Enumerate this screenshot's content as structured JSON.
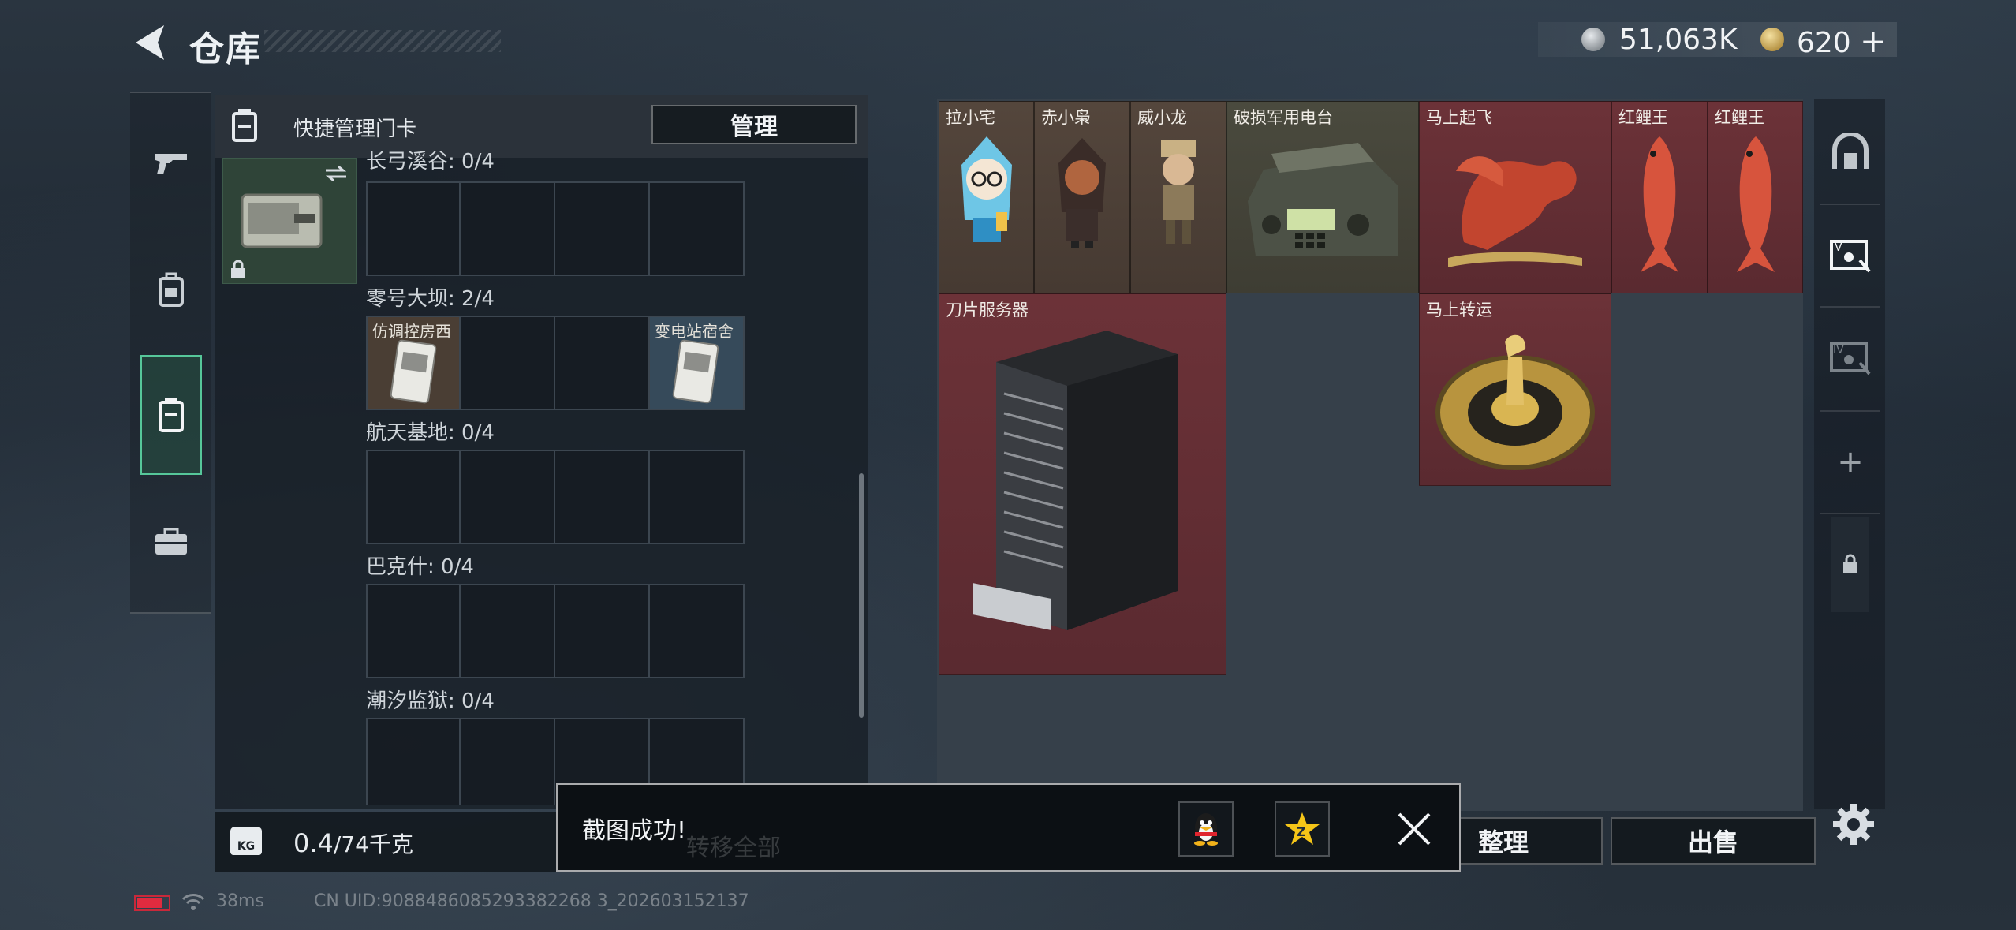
{
  "header": {
    "title": "仓库",
    "silver_value": "51,063K",
    "gold_value": "620",
    "gold_plus": "+"
  },
  "keycards": {
    "title": "快捷管理门卡",
    "manage_label": "管理",
    "sections": [
      {
        "name": "长弓溪谷: 0/4",
        "cards": []
      },
      {
        "name": "零号大坝: 2/4",
        "cards": [
          {
            "label": "仿调控房西",
            "slot": 0
          },
          {
            "label": "变电站宿舍",
            "slot": 3
          }
        ]
      },
      {
        "name": "航天基地: 0/4",
        "cards": []
      },
      {
        "name": "巴克什: 0/4",
        "cards": []
      },
      {
        "name": "潮汐监狱: 0/4",
        "cards": []
      }
    ]
  },
  "weight": {
    "current": "0.4",
    "max": "/74千克",
    "icon_text": "KG"
  },
  "items": [
    {
      "label": "拉小宅",
      "color": "brown"
    },
    {
      "label": "赤小枭",
      "color": "brown"
    },
    {
      "label": "威小龙",
      "color": "brown"
    },
    {
      "label": "破损军用电台",
      "color": "olive"
    },
    {
      "label": "马上起飞",
      "color": "red"
    },
    {
      "label": "红鲤王",
      "color": "red"
    },
    {
      "label": "红鲤王",
      "color": "red"
    },
    {
      "label": "刀片服务器",
      "color": "red"
    },
    {
      "label": "马上转运",
      "color": "red"
    }
  ],
  "side_rail": {
    "plus": "+",
    "tier_label": "IV"
  },
  "buttons": {
    "sort_label": "整理",
    "sell_label": "出售"
  },
  "toast": {
    "message": "截图成功!",
    "underlying_text": "转移全部"
  },
  "status": {
    "ping": "38ms",
    "uid": "CN UID:9088486085293382268 3_202603152137"
  },
  "colors": {
    "accent_green": "#56c79a",
    "rarity_red": "#6c3238",
    "rarity_brown": "#54463c"
  }
}
